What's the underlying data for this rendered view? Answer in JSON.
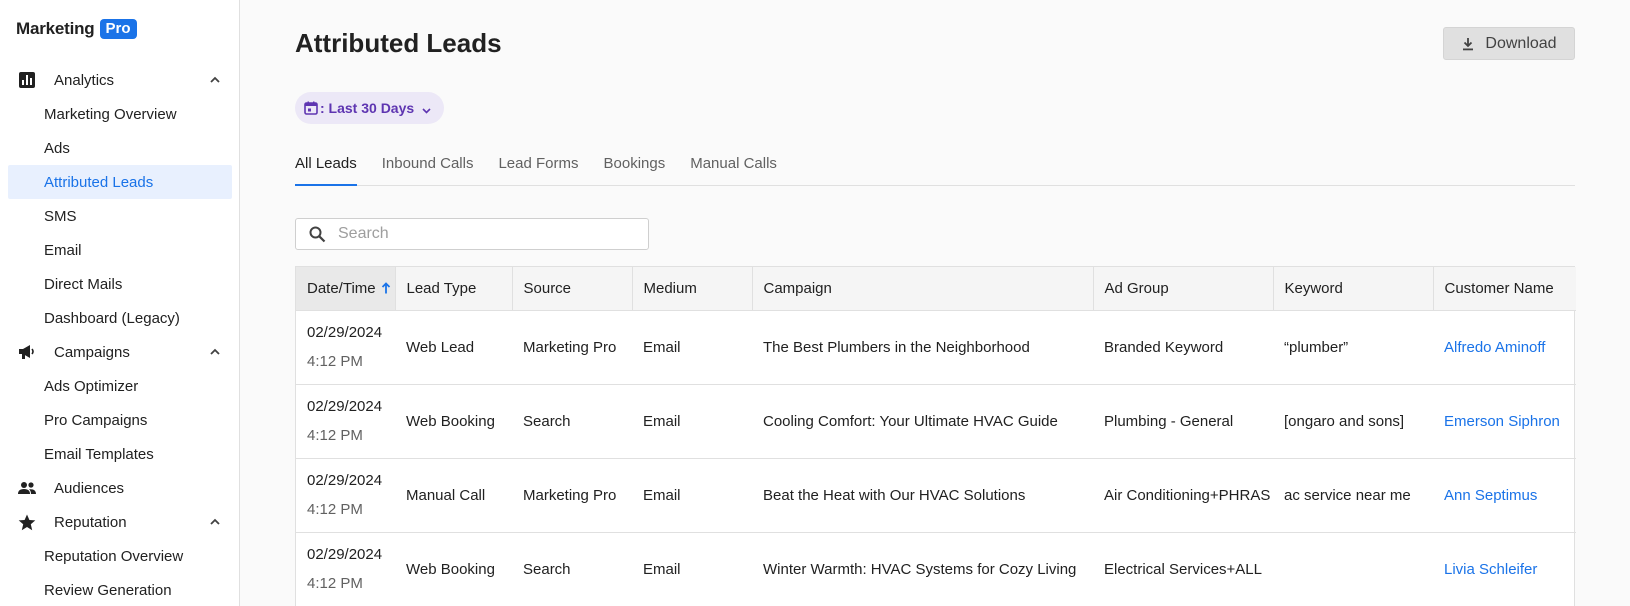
{
  "brand": {
    "name": "Marketing",
    "badge": "Pro"
  },
  "sidebar": {
    "sections": [
      {
        "label": "Analytics",
        "icon": "bar-chart-icon",
        "expanded": true,
        "items": [
          {
            "label": "Marketing Overview",
            "active": false
          },
          {
            "label": "Ads",
            "active": false
          },
          {
            "label": "Attributed Leads",
            "active": true
          },
          {
            "label": "SMS",
            "active": false
          },
          {
            "label": "Email",
            "active": false
          },
          {
            "label": "Direct Mails",
            "active": false
          },
          {
            "label": "Dashboard (Legacy)",
            "active": false
          }
        ]
      },
      {
        "label": "Campaigns",
        "icon": "megaphone-icon",
        "expanded": true,
        "items": [
          {
            "label": "Ads Optimizer",
            "active": false
          },
          {
            "label": "Pro Campaigns",
            "active": false
          },
          {
            "label": "Email Templates",
            "active": false
          }
        ]
      },
      {
        "label": "Audiences",
        "icon": "people-icon",
        "expanded": false,
        "items": []
      },
      {
        "label": "Reputation",
        "icon": "star-icon",
        "expanded": true,
        "items": [
          {
            "label": "Reputation Overview",
            "active": false
          },
          {
            "label": "Review Generation",
            "active": false
          }
        ]
      }
    ]
  },
  "header": {
    "title": "Attributed Leads",
    "download_label": "Download"
  },
  "filter": {
    "date_range": ": Last 30 Days"
  },
  "tabs": [
    {
      "label": "All Leads",
      "active": true
    },
    {
      "label": "Inbound Calls",
      "active": false
    },
    {
      "label": "Lead Forms",
      "active": false
    },
    {
      "label": "Bookings",
      "active": false
    },
    {
      "label": "Manual Calls",
      "active": false
    }
  ],
  "search": {
    "placeholder": "Search",
    "value": ""
  },
  "table": {
    "columns": [
      "Date/Time",
      "Lead Type",
      "Source",
      "Medium",
      "Campaign",
      "Ad Group",
      "Keyword",
      "Customer Name"
    ],
    "sorted_column": "Date/Time",
    "sort_direction": "ascending",
    "rows": [
      {
        "date": "02/29/2024",
        "time": "4:12 PM",
        "lead_type": "Web Lead",
        "source": "Marketing Pro",
        "medium": "Email",
        "campaign": "The Best Plumbers in the Neighborhood",
        "ad_group": "Branded Keyword",
        "keyword": "“plumber”",
        "customer": "Alfredo Aminoff"
      },
      {
        "date": "02/29/2024",
        "time": "4:12 PM",
        "lead_type": "Web Booking",
        "source": "Search",
        "medium": "Email",
        "campaign": "Cooling Comfort: Your Ultimate HVAC Guide",
        "ad_group": "Plumbing - General",
        "keyword": "[ongaro and sons]",
        "customer": "Emerson Siphron"
      },
      {
        "date": "02/29/2024",
        "time": "4:12 PM",
        "lead_type": "Manual Call",
        "source": "Marketing Pro",
        "medium": "Email",
        "campaign": "Beat the Heat with Our HVAC Solutions",
        "ad_group": "Air Conditioning+PHRAS",
        "keyword": "ac service near me",
        "customer": "Ann Septimus"
      },
      {
        "date": "02/29/2024",
        "time": "4:12 PM",
        "lead_type": "Web Booking",
        "source": "Search",
        "medium": "Email",
        "campaign": "Winter Warmth: HVAC Systems for Cozy Living",
        "ad_group": "Electrical Services+ALL",
        "keyword": "",
        "customer": "Livia Schleifer"
      }
    ]
  },
  "colors": {
    "accent": "#1a73e8",
    "active_nav_bg": "#e8f0fe",
    "chip_bg": "#ece8f7",
    "chip_text": "#5e35b1"
  }
}
